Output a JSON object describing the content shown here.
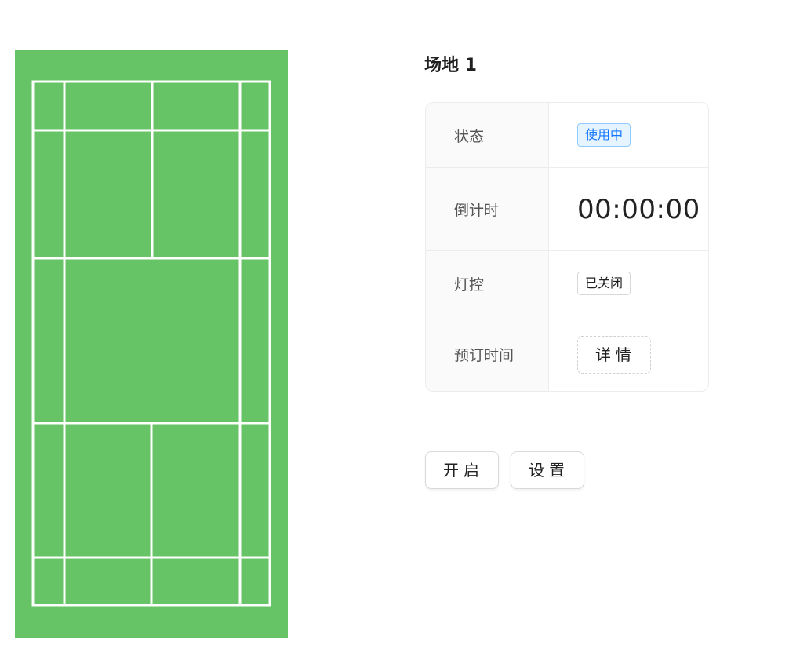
{
  "court": {
    "surface_color": "#66c466",
    "line_color": "#ffffff"
  },
  "venue": {
    "title": "场地 1"
  },
  "info": {
    "status_label": "状态",
    "status_value": "使用中",
    "countdown_label": "倒计时",
    "countdown_value": "00:00:00",
    "light_label": "灯控",
    "light_value": "已关闭",
    "booking_label": "预订时间",
    "booking_button": "详情"
  },
  "actions": {
    "open_label": "开启",
    "settings_label": "设置"
  },
  "colors": {
    "status_tag_bg": "#e6f4ff",
    "status_tag_text": "#1677ff"
  }
}
